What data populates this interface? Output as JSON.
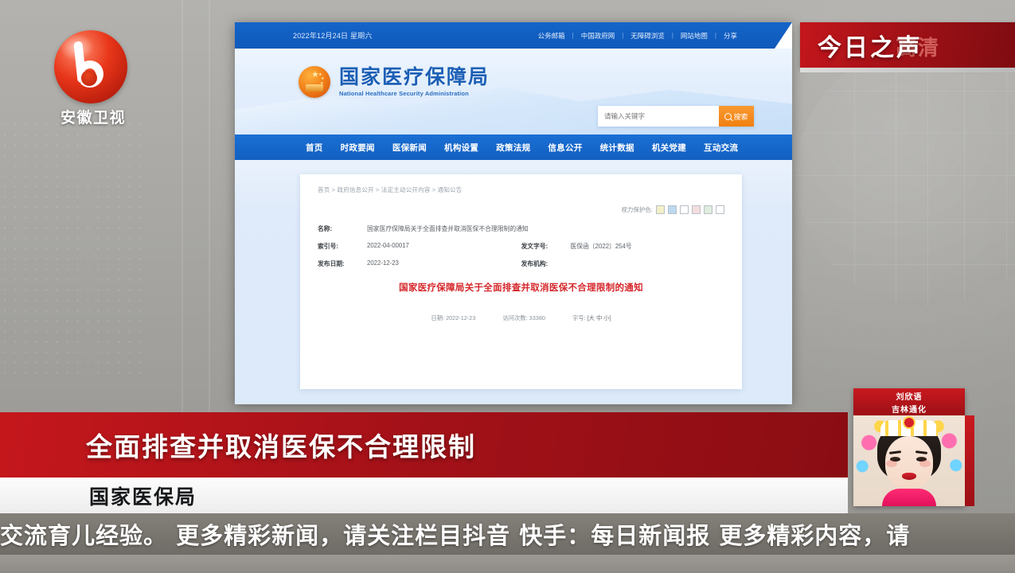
{
  "broadcast": {
    "channel_logo_name": "anhui-tv-logo",
    "channel_name": "安徽卫视",
    "program_banner": {
      "title": "今日之声",
      "ghost_text": "高清",
      "bg_color": "#a41118"
    },
    "lower_third": {
      "headline": "全面排查并取消医保不合理限制",
      "subhead": "国家医保局",
      "bar_color": "#a41118",
      "sub_bar_color": "#f2f2f2"
    },
    "reporter_card": {
      "name": "刘欣语",
      "location": "吉林通化"
    },
    "ticker": {
      "text": "妈交流育儿经验。      更多精彩新闻，请关注栏目抖音 快手：每日新闻报      更多精彩内容，请",
      "bg_color": "#78746e"
    }
  },
  "webpage": {
    "topbar": {
      "date": "2022年12月24日 星期六",
      "links": [
        "公务邮箱",
        "中国政府网",
        "无障碍浏览",
        "网站地图",
        "分享"
      ],
      "separator": "|",
      "bg_color": "#1160c3"
    },
    "masthead": {
      "emblem_name": "national-emblem",
      "title_cn": "国家医疗保障局",
      "title_en": "National Healthcare Security Administration",
      "search": {
        "placeholder": "请输入关键字",
        "value": "",
        "button_label": "搜索",
        "button_color": "#f0800f"
      }
    },
    "nav": {
      "items": [
        "首页",
        "时政要闻",
        "医保新闻",
        "机构设置",
        "政策法规",
        "信息公开",
        "统计数据",
        "机关党建",
        "互动交流"
      ],
      "bg_color": "#1260c1"
    },
    "article": {
      "breadcrumb": "首页 > 政府信息公开 > 法定主动公开内容 > 通知公告",
      "eye_protect": {
        "label": "视力保护色:",
        "swatches": [
          "#f2f0c8",
          "#bcd9ee",
          "#ffffff",
          "#f3dede",
          "#dfeede",
          "#ffffff"
        ]
      },
      "meta": [
        {
          "key": "名称:",
          "value": "国家医疗保障局关于全面排查并取消医保不合理限制的通知",
          "key2": "",
          "value2": ""
        },
        {
          "key": "索引号:",
          "value": "2022-04-00017",
          "key2": "发文字号:",
          "value2": "医保函〔2022〕254号"
        },
        {
          "key": "发布日期:",
          "value": "2022-12-23",
          "key2": "发布机构:",
          "value2": ""
        }
      ],
      "title": "国家医疗保障局关于全面排查并取消医保不合理限制的通知",
      "title_color": "#d5272b",
      "info": {
        "date_label": "日期:",
        "date_value": "2022-12-23",
        "visits_label": "访问次数:",
        "visits_value": "33380",
        "fontsize_label": "字号:",
        "fontsize_options": "[大 中 小]"
      }
    }
  }
}
